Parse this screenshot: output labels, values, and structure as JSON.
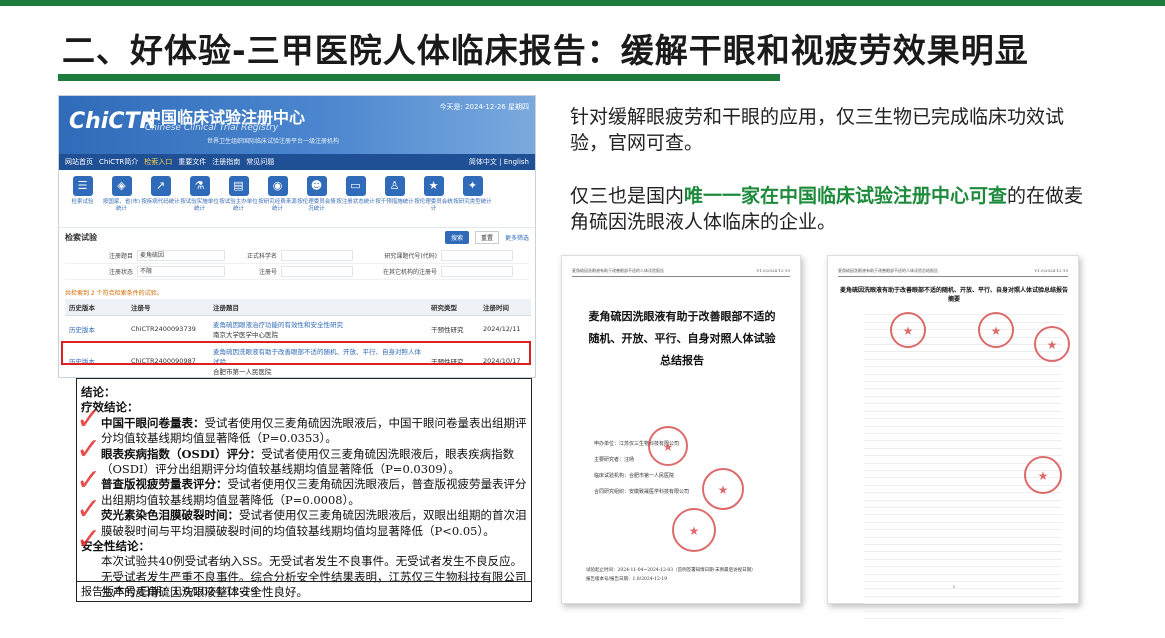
{
  "slide": {
    "title": "二、好体验-三甲医院人体临床报告：缓解干眼和视疲劳效果明显",
    "brand_color": "#1e7b3c"
  },
  "registry": {
    "logo": "ChiCTR",
    "cn_name": "中国临床试验注册中心",
    "en_name": "Chinese Clinical Trial Registry",
    "subtitle": "世界卫生组织国际临床试验注册平台一级注册机构",
    "date": "今天是: 2024-12-26 星期四",
    "nav": [
      "网站首页",
      "ChiCTR简介",
      "检索入口",
      "重要文件",
      "注册指南",
      "常见问题"
    ],
    "nav_active": "检索入口",
    "nav_right": "简体中文 | English",
    "icons": [
      {
        "icon": "list-icon",
        "glyph": "☰",
        "label": "检索试验"
      },
      {
        "icon": "map-icon",
        "glyph": "◈",
        "label": "按国家、省(市)统计"
      },
      {
        "icon": "chart-icon",
        "glyph": "↗",
        "label": "按疾病代码统计"
      },
      {
        "icon": "flask-icon",
        "glyph": "⚗",
        "label": "按试验实施单位统计"
      },
      {
        "icon": "document-icon",
        "glyph": "▤",
        "label": "按试验主办单位统计"
      },
      {
        "icon": "camera-icon",
        "glyph": "◉",
        "label": "按研究经费来源统计"
      },
      {
        "icon": "people-icon",
        "glyph": "☻",
        "label": "按伦理委员会情况统计"
      },
      {
        "icon": "card-icon",
        "glyph": "▭",
        "label": "按注册状态统计"
      },
      {
        "icon": "user-icon",
        "glyph": "♙",
        "label": "按干预措施统计"
      },
      {
        "icon": "star-icon",
        "glyph": "★",
        "label": "按伦理委员会统计"
      },
      {
        "icon": "sparkle-icon",
        "glyph": "✦",
        "label": "按研究类型统计"
      }
    ],
    "search_title": "检索试验",
    "search_button": "搜索",
    "reset_button": "重置",
    "more_filter": "更多筛选",
    "form": {
      "row1": {
        "label1": "注册题目",
        "value1": "麦角硫因",
        "label2": "正式科学名",
        "label3": "研究课题代号(代码)"
      },
      "row2": {
        "label1": "注册状态",
        "value1": "不限",
        "label2": "注册号",
        "label3": "在其它机构的注册号"
      }
    },
    "result_count": "共检索到 2 个符合检索条件的试验。",
    "table": {
      "headers": [
        "历史版本",
        "注册号",
        "注册题目",
        "研究类型",
        "注册时间"
      ],
      "rows": [
        {
          "history": "历史版本",
          "reg_no": "ChiCTR2400093739",
          "title": "麦角硫因眼液治疗功能的有效性和安全性研究",
          "sponsor": "南京大学医学中心医院",
          "type": "干预性研究",
          "date": "2024/12/11"
        },
        {
          "history": "历史版本",
          "reg_no": "ChiCTR2400090987",
          "title": "麦角硫因洗眼液有助于改善眼部不适的随机、开放、平行、自身对照人体试验",
          "sponsor": "合肥市第一人民医院",
          "type": "干预性研究",
          "date": "2024/10/17"
        }
      ]
    }
  },
  "report": {
    "cut_line": "麦角硫因洗眼液有助于改善眼部不适的人体试验",
    "conclusion": "结论：",
    "efficacy": "疗效结论：",
    "items": [
      {
        "head": "中国干眼问卷量表：",
        "text": "受试者使用仅三麦角硫因洗眼液后，中国干眼问卷量表出组期评分均值较基线期均值显著降低（P=0.0353）。"
      },
      {
        "head": "眼表疾病指数（OSDI）评分：",
        "text": "受试者使用仅三麦角硫因洗眼液后，眼表疾病指数（OSDI）评分出组期评分均值较基线期均值显著降低（P=0.0309）。"
      },
      {
        "head": "普查版视疲劳量表评分：",
        "text": "受试者使用仅三麦角硫因洗眼液后，普查版视疲劳量表评分出组期均值较基线期均值显著降低（P=0.0008）。"
      },
      {
        "head": "荧光素染色泪膜破裂时间：",
        "text": "受试者使用仅三麦角硫因洗眼液后，双眼出组期的首次泪膜破裂时间与平均泪膜破裂时间的均值较基线期均值均显著降低（P<0.05）。"
      }
    ],
    "safety": "安全性结论：",
    "safety_text": "本次试验共40例受试者纳入SS。无受试者发生不良事件。无受试者发生不良反应。无受试者发生严重不良事件。综合分析安全性结果表明，江苏仅三生物科技有限公司生产的麦角硫因洗眼液整体安全性良好。",
    "version": "报告版本号/日期：1.0/2024-12-19",
    "mark_color": "#e23030"
  },
  "right_text": {
    "para1": "针对缓解眼疲劳和干眼的应用，仅三生物已完成临床功效试验，官网可查。",
    "para2_pre": "仅三也是国内",
    "para2_hl": "唯一一家在中国临床试验注册中心可查",
    "para2_post": "的在做麦角硫因洗眼液人体临床的企业。",
    "highlight_color": "#1e8a3c"
  },
  "doc1": {
    "header_left": "麦角硫因洗眼液有助于改善眼部不适的人体试验报告",
    "header_right": "V1.0/2024-12-19",
    "title": "麦角硫因洗眼液有助于改善眼部不适的随机、开放、平行、自身对照人体试验总结报告",
    "info": [
      "申办单位：江苏仅三生物科技有限公司",
      "主要研究者：汪旸",
      "临床试验机构：合肥市第一人民医院",
      "合同研究组织：安徽致晟医学科技有限公司"
    ],
    "footer1": "试验起止时间：2024-11-04~2024-12-03（首例签署知情日期-末例最后访视日期）",
    "footer2": "报告版本号/报告日期：1.0/2024-12-19"
  },
  "doc2": {
    "header_left": "麦角硫因洗眼液有助于改善眼部不适的人体试验总结报告",
    "header_right": "V1.0/2024-12-19",
    "title": "麦角硫因洗眼液有助于改善眼部不适的随机、开放、平行、自身对照人体试验总结报告摘要",
    "page": "1"
  }
}
